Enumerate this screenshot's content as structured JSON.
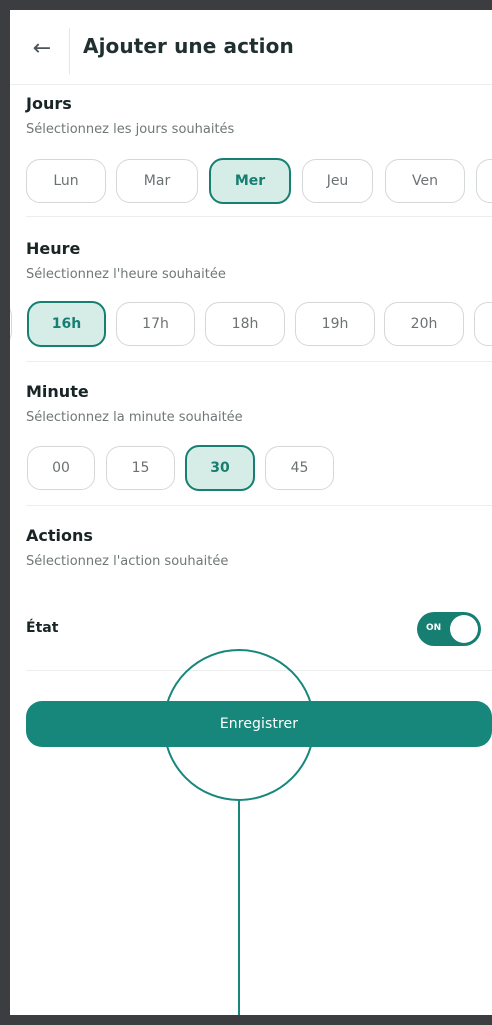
{
  "header": {
    "back_icon": "←",
    "title": "Ajouter une action"
  },
  "days": {
    "title": "Jours",
    "subtitle": "Sélectionnez les jours souhaités",
    "chips": [
      "Lun",
      "Mar",
      "Mer",
      "Jeu",
      "Ven"
    ],
    "selected": "Mer"
  },
  "hour": {
    "title": "Heure",
    "subtitle": "Sélectionnez l'heure souhaitée",
    "chips": [
      "16h",
      "17h",
      "18h",
      "19h",
      "20h"
    ],
    "selected": "16h"
  },
  "minute": {
    "title": "Minute",
    "subtitle": "Sélectionnez la minute souhaitée",
    "chips": [
      "00",
      "15",
      "30",
      "45"
    ],
    "selected": "30"
  },
  "actions": {
    "title": "Actions",
    "subtitle": "Sélectionnez l'action souhaitée",
    "state_label": "État",
    "toggle_text": "ON",
    "toggle_on": true
  },
  "save_button": {
    "label": "Enregistrer"
  },
  "colors": {
    "accent": "#16877a",
    "accent_light": "#d6ece6",
    "frame": "#3b3d40"
  }
}
